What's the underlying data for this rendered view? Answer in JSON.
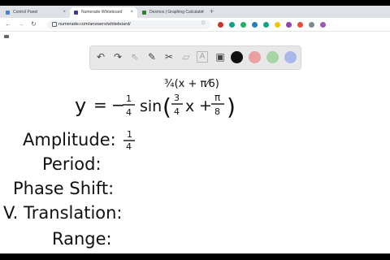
{
  "browser": {
    "tabs": [
      {
        "label": "Control Panel",
        "close": "×",
        "favicon_color": "#4a7fd4"
      },
      {
        "label": "Numerade Whiteboard",
        "close": "×",
        "favicon_color": "#3b3b98"
      },
      {
        "label": "Desmos | Graphing Calculator",
        "close": "×",
        "favicon_color": "#2e7d32"
      }
    ],
    "new_tab": "+",
    "window_controls": {
      "minimize": "–",
      "maximize": "□",
      "close": "×"
    },
    "nav": {
      "back": "←",
      "forward": "→",
      "reload": "↻"
    },
    "url": "numerade.com/answers/whiteboard/",
    "star": "☆",
    "extension_colors": [
      "#c0392b",
      "#16a085",
      "#27ae60",
      "#2980b9",
      "#16a085",
      "#f1c40f",
      "#8e44ad",
      "#e74c3c",
      "#7f8c8d",
      "#9b59b6"
    ]
  },
  "whiteboard_tools": {
    "undo": "↶",
    "redo": "↷",
    "select": "⇖",
    "pen": "✎",
    "tools": "✂",
    "eraser": "▱",
    "text": "A",
    "image": "▣",
    "colors": [
      "#111111",
      "#e8a0a0",
      "#a8d4a8",
      "#a9b8e8"
    ]
  },
  "work": {
    "equation_y": "y",
    "equals": "=",
    "minus": "−",
    "coef_num": "1",
    "coef_den": "4",
    "sin": "sin",
    "lparen": "(",
    "rparen": ")",
    "b_num": "3",
    "b_den": "4",
    "x": "x",
    "plus": "+",
    "c_num": "π",
    "c_den": "8",
    "factored": "¾(x + π⁄6)",
    "amplitude_label": "Amplitude:",
    "amplitude_num": "1",
    "amplitude_den": "4",
    "period_label": "Period:",
    "phase_label": "Phase Shift:",
    "vtrans_label": "V. Translation:",
    "range_label": "Range:"
  }
}
